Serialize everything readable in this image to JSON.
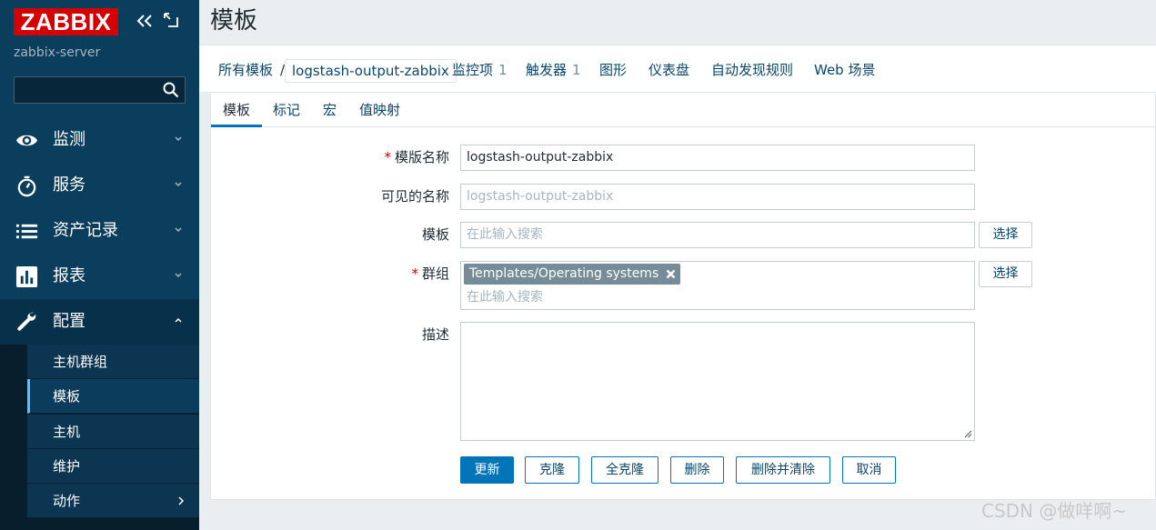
{
  "app": {
    "logo": "ZABBIX",
    "server_name": "zabbix-server",
    "brand_color": "#d40000",
    "sidebar_color": "#0b3e5c"
  },
  "sidebar": {
    "search_value": "",
    "menu": [
      {
        "label": "监测",
        "icon": "eye-icon"
      },
      {
        "label": "服务",
        "icon": "stopwatch-icon"
      },
      {
        "label": "资产记录",
        "icon": "list-icon"
      },
      {
        "label": "报表",
        "icon": "bar-chart-icon"
      },
      {
        "label": "配置",
        "icon": "wrench-icon",
        "expanded": true
      }
    ],
    "submenu": [
      {
        "label": "主机群组"
      },
      {
        "label": "模板",
        "active": true
      },
      {
        "label": "主机"
      },
      {
        "label": "维护"
      },
      {
        "label": "动作"
      }
    ]
  },
  "page": {
    "title": "模板"
  },
  "breadcrumb": {
    "all_templates": "所有模板",
    "separator": "/",
    "current": "logstash-output-zabbix",
    "links": [
      {
        "label": "监控项",
        "count": "1"
      },
      {
        "label": "触发器",
        "count": "1"
      },
      {
        "label": "图形",
        "count": ""
      },
      {
        "label": "仪表盘",
        "count": ""
      },
      {
        "label": "自动发现规则",
        "count": ""
      },
      {
        "label": "Web 场景",
        "count": ""
      }
    ]
  },
  "tabs": [
    "模板",
    "标记",
    "宏",
    "值映射"
  ],
  "form": {
    "template_name_label": "模版名称",
    "template_name_value": "logstash-output-zabbix",
    "visible_name_label": "可见的名称",
    "visible_name_placeholder": "logstash-output-zabbix",
    "templates_label": "模板",
    "templates_placeholder": "在此输入搜索",
    "groups_label": "群组",
    "group_tag": "Templates/Operating systems",
    "groups_placeholder": "在此输入搜索",
    "description_label": "描述",
    "description_value": "",
    "select_label": "选择"
  },
  "buttons": {
    "update": "更新",
    "clone": "克隆",
    "full_clone": "全克隆",
    "delete": "删除",
    "delete_clear": "删除并清除",
    "cancel": "取消"
  },
  "watermark": "CSDN @做咩啊~"
}
